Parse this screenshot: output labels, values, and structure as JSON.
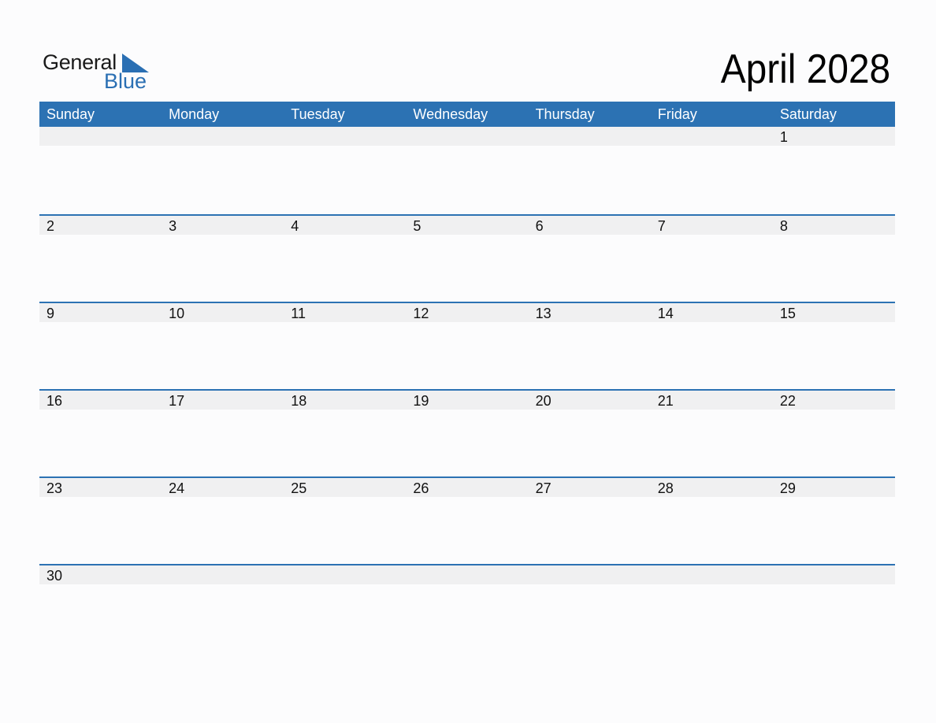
{
  "logo": {
    "line1": "General",
    "line2": "Blue",
    "accent_color": "#2a6fb3"
  },
  "title": "April 2028",
  "colors": {
    "header_bg": "#2c72b3",
    "header_text": "#ffffff",
    "strip_bg": "#f0f0f1"
  },
  "weekdays": [
    "Sunday",
    "Monday",
    "Tuesday",
    "Wednesday",
    "Thursday",
    "Friday",
    "Saturday"
  ],
  "weeks": [
    [
      "",
      "",
      "",
      "",
      "",
      "",
      "1"
    ],
    [
      "2",
      "3",
      "4",
      "5",
      "6",
      "7",
      "8"
    ],
    [
      "9",
      "10",
      "11",
      "12",
      "13",
      "14",
      "15"
    ],
    [
      "16",
      "17",
      "18",
      "19",
      "20",
      "21",
      "22"
    ],
    [
      "23",
      "24",
      "25",
      "26",
      "27",
      "28",
      "29"
    ],
    [
      "30",
      "",
      "",
      "",
      "",
      "",
      ""
    ]
  ]
}
